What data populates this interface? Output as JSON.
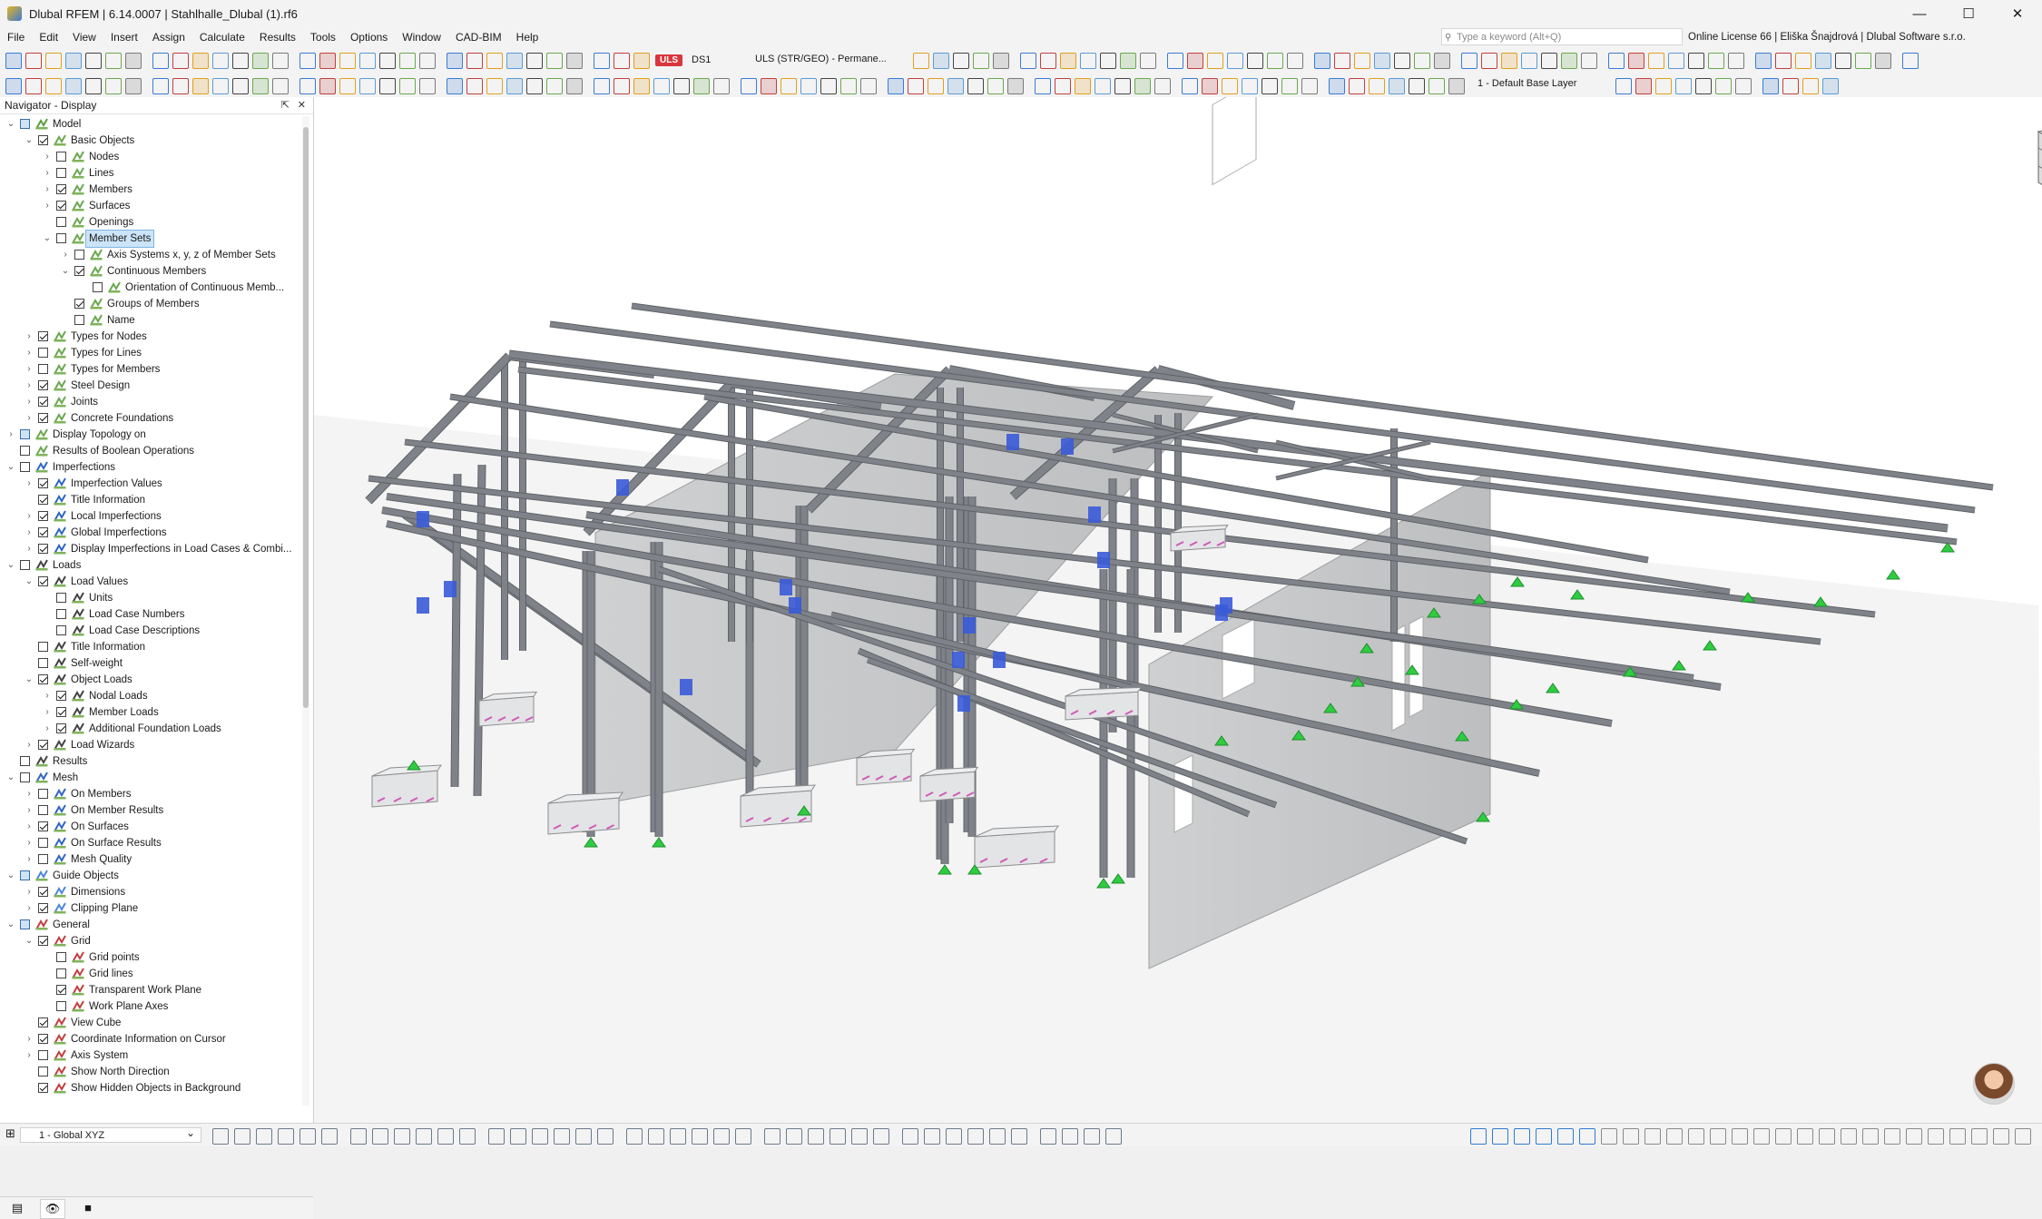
{
  "window": {
    "title": "Dlubal RFEM | 6.14.0007 | Stahlhalle_Dlubal (1).rf6",
    "minimize": "—",
    "maximize": "☐",
    "close": "✕"
  },
  "menu": [
    "File",
    "Edit",
    "View",
    "Insert",
    "Assign",
    "Calculate",
    "Results",
    "Tools",
    "Options",
    "Window",
    "CAD-BIM",
    "Help"
  ],
  "search": {
    "placeholder": "Type a keyword (Alt+Q)"
  },
  "license": "Online License 66 | Eliška Šnajdrová | Dlubal Software s.r.o.",
  "toolbar": {
    "load_badge": "ULS",
    "design_situation": "DS1",
    "combination": "ULS (STR/GEO) - Permane...",
    "layer": "1 - Default Base Layer"
  },
  "navigator": {
    "title": "Navigator - Display",
    "pin": "⇱",
    "close": "✕",
    "items": [
      {
        "label": "Model",
        "level": 0,
        "exp": "v",
        "check": "part",
        "icon": "model-icon"
      },
      {
        "label": "Basic Objects",
        "level": 1,
        "exp": "v",
        "check": "on",
        "icon": "objects-icon"
      },
      {
        "label": "Nodes",
        "level": 2,
        "exp": ">",
        "check": "off",
        "icon": "objects-icon"
      },
      {
        "label": "Lines",
        "level": 2,
        "exp": ">",
        "check": "off",
        "icon": "objects-icon"
      },
      {
        "label": "Members",
        "level": 2,
        "exp": ">",
        "check": "on",
        "icon": "objects-icon"
      },
      {
        "label": "Surfaces",
        "level": 2,
        "exp": ">",
        "check": "on",
        "icon": "objects-icon"
      },
      {
        "label": "Openings",
        "level": 2,
        "exp": "",
        "check": "off",
        "icon": "objects-icon"
      },
      {
        "label": "Member Sets",
        "level": 2,
        "exp": "v",
        "check": "off",
        "icon": "objects-icon",
        "selected": true
      },
      {
        "label": "Axis Systems x, y, z of Member Sets",
        "level": 3,
        "exp": ">",
        "check": "off",
        "icon": "objects-icon"
      },
      {
        "label": "Continuous Members",
        "level": 3,
        "exp": "v",
        "check": "on",
        "icon": "objects-icon"
      },
      {
        "label": "Orientation of Continuous Memb...",
        "level": 4,
        "exp": "",
        "check": "off",
        "icon": "objects-icon"
      },
      {
        "label": "Groups of Members",
        "level": 3,
        "exp": "",
        "check": "on",
        "icon": "objects-icon"
      },
      {
        "label": "Name",
        "level": 3,
        "exp": "",
        "check": "off",
        "icon": "objects-icon"
      },
      {
        "label": "Types for Nodes",
        "level": 1,
        "exp": ">",
        "check": "on",
        "icon": "objects-icon"
      },
      {
        "label": "Types for Lines",
        "level": 1,
        "exp": ">",
        "check": "off",
        "icon": "objects-icon"
      },
      {
        "label": "Types for Members",
        "level": 1,
        "exp": ">",
        "check": "off",
        "icon": "objects-icon"
      },
      {
        "label": "Steel Design",
        "level": 1,
        "exp": ">",
        "check": "on",
        "icon": "objects-icon"
      },
      {
        "label": "Joints",
        "level": 1,
        "exp": ">",
        "check": "on",
        "icon": "objects-icon"
      },
      {
        "label": "Concrete Foundations",
        "level": 1,
        "exp": ">",
        "check": "on",
        "icon": "objects-icon"
      },
      {
        "label": "Display Topology on",
        "level": 0,
        "exp": ">",
        "check": "part",
        "icon": "objects-icon"
      },
      {
        "label": "Results of Boolean Operations",
        "level": 0,
        "exp": "",
        "check": "off",
        "icon": "objects-icon"
      },
      {
        "label": "Imperfections",
        "level": 0,
        "exp": "v",
        "check": "off",
        "icon": "imperfection-icon"
      },
      {
        "label": "Imperfection Values",
        "level": 1,
        "exp": ">",
        "check": "on",
        "icon": "imperfection-icon"
      },
      {
        "label": "Title Information",
        "level": 1,
        "exp": "",
        "check": "on",
        "icon": "imperfection-icon"
      },
      {
        "label": "Local Imperfections",
        "level": 1,
        "exp": ">",
        "check": "on",
        "icon": "imperfection-icon"
      },
      {
        "label": "Global Imperfections",
        "level": 1,
        "exp": ">",
        "check": "on",
        "icon": "imperfection-icon"
      },
      {
        "label": "Display Imperfections in Load Cases & Combi...",
        "level": 1,
        "exp": ">",
        "check": "on",
        "icon": "imperfection-icon"
      },
      {
        "label": "Loads",
        "level": 0,
        "exp": "v",
        "check": "off",
        "icon": "load-icon"
      },
      {
        "label": "Load Values",
        "level": 1,
        "exp": "v",
        "check": "on",
        "icon": "load-icon"
      },
      {
        "label": "Units",
        "level": 2,
        "exp": "",
        "check": "off",
        "icon": "load-icon"
      },
      {
        "label": "Load Case Numbers",
        "level": 2,
        "exp": "",
        "check": "off",
        "icon": "load-icon"
      },
      {
        "label": "Load Case Descriptions",
        "level": 2,
        "exp": "",
        "check": "off",
        "icon": "load-icon"
      },
      {
        "label": "Title Information",
        "level": 1,
        "exp": "",
        "check": "off",
        "icon": "load-icon"
      },
      {
        "label": "Self-weight",
        "level": 1,
        "exp": "",
        "check": "off",
        "icon": "load-icon"
      },
      {
        "label": "Object Loads",
        "level": 1,
        "exp": "v",
        "check": "on",
        "icon": "load-icon"
      },
      {
        "label": "Nodal Loads",
        "level": 2,
        "exp": ">",
        "check": "on",
        "icon": "load-icon"
      },
      {
        "label": "Member Loads",
        "level": 2,
        "exp": ">",
        "check": "on",
        "icon": "load-icon"
      },
      {
        "label": "Additional Foundation Loads",
        "level": 2,
        "exp": ">",
        "check": "on",
        "icon": "load-icon"
      },
      {
        "label": "Load Wizards",
        "level": 1,
        "exp": ">",
        "check": "on",
        "icon": "load-icon"
      },
      {
        "label": "Results",
        "level": 0,
        "exp": "",
        "check": "off",
        "icon": "load-icon"
      },
      {
        "label": "Mesh",
        "level": 0,
        "exp": "v",
        "check": "off",
        "icon": "mesh-icon"
      },
      {
        "label": "On Members",
        "level": 1,
        "exp": ">",
        "check": "off",
        "icon": "mesh-icon"
      },
      {
        "label": "On Member Results",
        "level": 1,
        "exp": ">",
        "check": "off",
        "icon": "mesh-icon"
      },
      {
        "label": "On Surfaces",
        "level": 1,
        "exp": ">",
        "check": "on",
        "icon": "mesh-icon"
      },
      {
        "label": "On Surface Results",
        "level": 1,
        "exp": ">",
        "check": "off",
        "icon": "mesh-icon"
      },
      {
        "label": "Mesh Quality",
        "level": 1,
        "exp": ">",
        "check": "off",
        "icon": "mesh-icon"
      },
      {
        "label": "Guide Objects",
        "level": 0,
        "exp": "v",
        "check": "part",
        "icon": "guide-icon"
      },
      {
        "label": "Dimensions",
        "level": 1,
        "exp": ">",
        "check": "on",
        "icon": "guide-icon"
      },
      {
        "label": "Clipping Plane",
        "level": 1,
        "exp": ">",
        "check": "on",
        "icon": "guide-icon"
      },
      {
        "label": "General",
        "level": 0,
        "exp": "v",
        "check": "part",
        "icon": "general-icon"
      },
      {
        "label": "Grid",
        "level": 1,
        "exp": "v",
        "check": "on",
        "icon": "general-icon"
      },
      {
        "label": "Grid points",
        "level": 2,
        "exp": "",
        "check": "off",
        "icon": "general-icon"
      },
      {
        "label": "Grid lines",
        "level": 2,
        "exp": "",
        "check": "off",
        "icon": "general-icon"
      },
      {
        "label": "Transparent Work Plane",
        "level": 2,
        "exp": "",
        "check": "on",
        "icon": "general-icon"
      },
      {
        "label": "Work Plane Axes",
        "level": 2,
        "exp": "",
        "check": "off",
        "icon": "general-icon"
      },
      {
        "label": "View Cube",
        "level": 1,
        "exp": "",
        "check": "on",
        "icon": "general-icon"
      },
      {
        "label": "Coordinate Information on Cursor",
        "level": 1,
        "exp": ">",
        "check": "on",
        "icon": "general-icon"
      },
      {
        "label": "Axis System",
        "level": 1,
        "exp": ">",
        "check": "off",
        "icon": "general-icon"
      },
      {
        "label": "Show North Direction",
        "level": 1,
        "exp": "",
        "check": "off",
        "icon": "general-icon"
      },
      {
        "label": "Show Hidden Objects in Background",
        "level": 1,
        "exp": "",
        "check": "on",
        "icon": "general-icon"
      }
    ],
    "tabs": [
      "data-tab",
      "display-tab",
      "views-tab"
    ]
  },
  "statusbar": {
    "coordinate_system": "1 - Global XYZ"
  },
  "colors": {
    "accent": "#0078d4",
    "selection": "#cce4f7",
    "member": "#7f8389",
    "surface": "#c9cacb",
    "support": "#2ecc40",
    "joint": "#3a5bd9"
  }
}
